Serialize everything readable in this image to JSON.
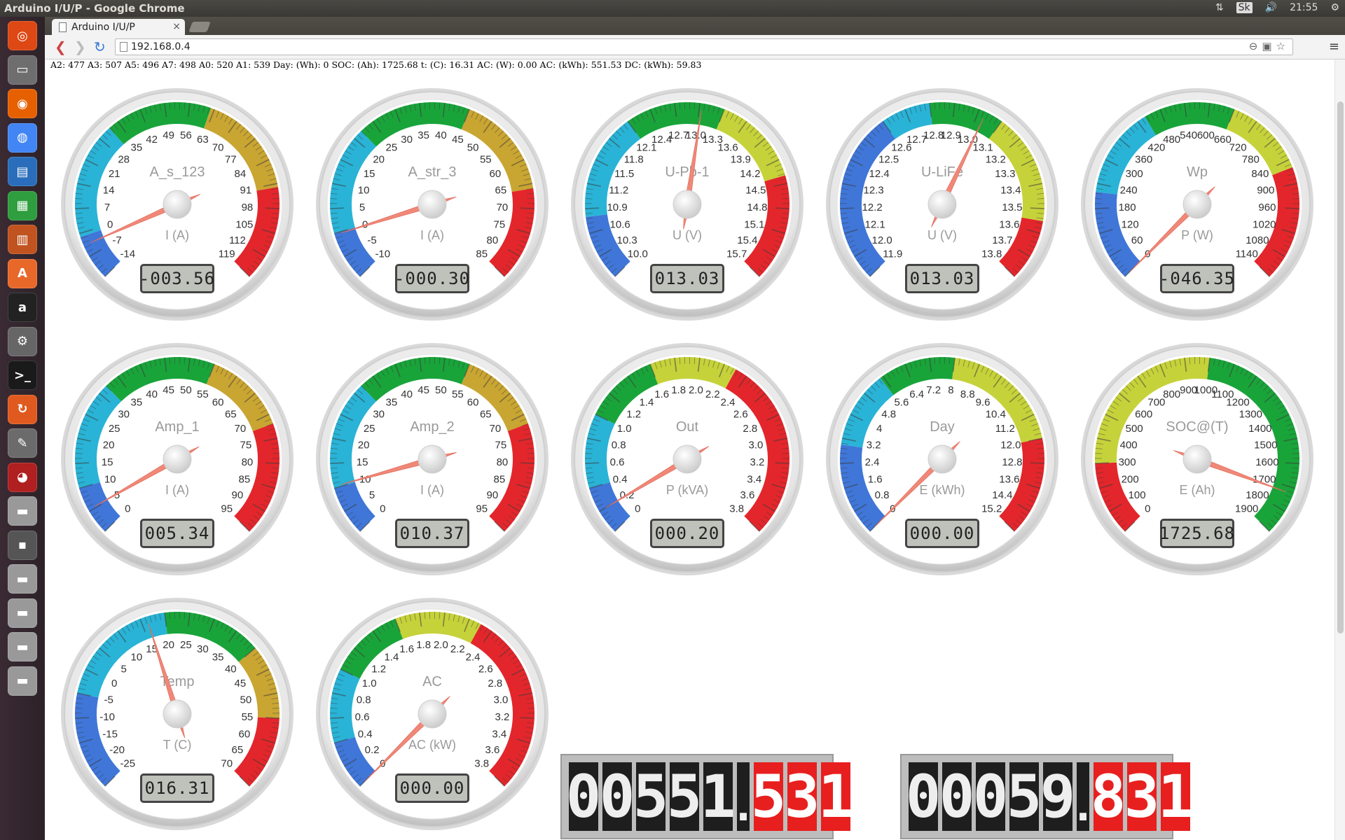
{
  "window": {
    "title": "Arduino I/U/P - Google Chrome",
    "tray": {
      "keyboard": "Sk",
      "time": "21:55"
    }
  },
  "browser": {
    "tab_title": "Arduino I/U/P",
    "tab_close": "×",
    "url": "192.168.0.4",
    "menu_icon": "≡"
  },
  "launcher_icons": [
    "ubuntu-logo-icon",
    "files-icon",
    "firefox-icon",
    "chrome-icon",
    "writer-icon",
    "calc-icon",
    "impress-icon",
    "software-center-icon",
    "amazon-icon",
    "settings-icon",
    "terminal-icon",
    "update-manager-icon",
    "gimp-icon",
    "network-icon",
    "drive-icon",
    "floppy-icon",
    "drive-icon",
    "drive-icon",
    "drive-icon",
    "drive-icon"
  ],
  "status_line": "A2: 477 A3: 507 A5: 496 A7: 498 A0: 520 A1: 539 Day: (Wh): 0 SOC: (Ah): 1725.68 t: (C): 16.31 AC: (W): 0.00 AC: (kWh): 551.53 DC: (kWh): 59.83",
  "gauges": [
    {
      "id": "g1",
      "title": "A_s_123",
      "units": "I (A)",
      "value": -3.56,
      "display": "-003.56",
      "min": -14,
      "max": 119,
      "ticks": [
        "-14",
        "-7",
        "0",
        "7",
        "14",
        "21",
        "28",
        "35",
        "42",
        "49",
        "56",
        "63",
        "70",
        "77",
        "84",
        "91",
        "98",
        "105",
        "112",
        "119"
      ],
      "highlights": [
        {
          "from": -14,
          "to": -1,
          "color": "#3f76d8"
        },
        {
          "from": -1,
          "to": 32,
          "color": "#29b3d6"
        },
        {
          "from": 32,
          "to": 62,
          "color": "#19a43a"
        },
        {
          "from": 62,
          "to": 92,
          "color": "#c9a532"
        },
        {
          "from": 92,
          "to": 119,
          "color": "#e3262b"
        }
      ]
    },
    {
      "id": "g2",
      "title": "A_str_3",
      "units": "I (A)",
      "value": -0.3,
      "display": "-000.30",
      "min": -10,
      "max": 85,
      "ticks": [
        "-10",
        "-5",
        "0",
        "5",
        "10",
        "15",
        "20",
        "25",
        "30",
        "35",
        "40",
        "45",
        "50",
        "55",
        "60",
        "65",
        "70",
        "75",
        "80",
        "85"
      ],
      "highlights": [
        {
          "from": -10,
          "to": 0,
          "color": "#3f76d8"
        },
        {
          "from": 0,
          "to": 22,
          "color": "#29b3d6"
        },
        {
          "from": 22,
          "to": 45,
          "color": "#19a43a"
        },
        {
          "from": 45,
          "to": 66,
          "color": "#c9a532"
        },
        {
          "from": 66,
          "to": 85,
          "color": "#e3262b"
        }
      ]
    },
    {
      "id": "g3",
      "title": "U-Pb-1",
      "units": "U (V)",
      "value": 13.03,
      "display": "013.03",
      "min": 10.0,
      "max": 15.7,
      "ticks": [
        "10.0",
        "10.3",
        "10.6",
        "10.9",
        "11.2",
        "11.5",
        "11.8",
        "12.1",
        "12.4",
        "12.7",
        "13.0",
        "13.3",
        "13.6",
        "13.9",
        "14.2",
        "14.5",
        "14.8",
        "15.1",
        "15.4",
        "15.7"
      ],
      "highlights": [
        {
          "from": 10.0,
          "to": 10.8,
          "color": "#3f76d8"
        },
        {
          "from": 10.8,
          "to": 12.1,
          "color": "#29b3d6"
        },
        {
          "from": 12.1,
          "to": 13.3,
          "color": "#19a43a"
        },
        {
          "from": 13.3,
          "to": 14.4,
          "color": "#c6d23a"
        },
        {
          "from": 14.4,
          "to": 15.7,
          "color": "#e3262b"
        }
      ]
    },
    {
      "id": "g4",
      "title": "U-LiFe",
      "units": "U (V)",
      "value": 13.03,
      "display": "013.03",
      "min": 11.9,
      "max": 13.8,
      "ticks": [
        "11.9",
        "12.0",
        "12.1",
        "12.2",
        "12.3",
        "12.4",
        "12.5",
        "12.6",
        "12.7",
        "12.8",
        "12.9",
        "13.0",
        "13.1",
        "13.2",
        "13.3",
        "13.4",
        "13.5",
        "13.6",
        "13.7",
        "13.8"
      ],
      "highlights": [
        {
          "from": 11.9,
          "to": 12.6,
          "color": "#3f76d8"
        },
        {
          "from": 12.6,
          "to": 12.8,
          "color": "#29b3d6"
        },
        {
          "from": 12.8,
          "to": 13.1,
          "color": "#19a43a"
        },
        {
          "from": 13.1,
          "to": 13.55,
          "color": "#c6d23a"
        },
        {
          "from": 13.55,
          "to": 13.8,
          "color": "#e3262b"
        }
      ]
    },
    {
      "id": "g5",
      "title": "Wp",
      "units": "P (W)",
      "value": -46.35,
      "display": "-046.35",
      "min": 0,
      "max": 1140,
      "ticks": [
        "0",
        "60",
        "120",
        "180",
        "240",
        "300",
        "360",
        "420",
        "480",
        "540",
        "600",
        "660",
        "720",
        "780",
        "840",
        "900",
        "960",
        "1020",
        "1080",
        "1140"
      ],
      "highlights": [
        {
          "from": 0,
          "to": 220,
          "color": "#3f76d8"
        },
        {
          "from": 220,
          "to": 440,
          "color": "#29b3d6"
        },
        {
          "from": 440,
          "to": 660,
          "color": "#19a43a"
        },
        {
          "from": 660,
          "to": 860,
          "color": "#c6d23a"
        },
        {
          "from": 860,
          "to": 1140,
          "color": "#e3262b"
        }
      ]
    },
    {
      "id": "g6",
      "title": "Amp_1",
      "units": "I (A)",
      "value": 5.34,
      "display": "005.34",
      "min": 0,
      "max": 95,
      "ticks": [
        "0",
        "5",
        "10",
        "15",
        "20",
        "25",
        "30",
        "35",
        "40",
        "45",
        "50",
        "55",
        "60",
        "65",
        "70",
        "75",
        "80",
        "85",
        "90",
        "95"
      ],
      "highlights": [
        {
          "from": 0,
          "to": 10,
          "color": "#3f76d8"
        },
        {
          "from": 10,
          "to": 32,
          "color": "#29b3d6"
        },
        {
          "from": 32,
          "to": 55,
          "color": "#19a43a"
        },
        {
          "from": 55,
          "to": 72,
          "color": "#c9a532"
        },
        {
          "from": 72,
          "to": 95,
          "color": "#e3262b"
        }
      ]
    },
    {
      "id": "g7",
      "title": "Amp_2",
      "units": "I (A)",
      "value": 10.37,
      "display": "010.37",
      "min": 0,
      "max": 95,
      "ticks": [
        "0",
        "5",
        "10",
        "15",
        "20",
        "25",
        "30",
        "35",
        "40",
        "45",
        "50",
        "55",
        "60",
        "65",
        "70",
        "75",
        "80",
        "85",
        "90",
        "95"
      ],
      "highlights": [
        {
          "from": 0,
          "to": 10,
          "color": "#3f76d8"
        },
        {
          "from": 10,
          "to": 32,
          "color": "#29b3d6"
        },
        {
          "from": 32,
          "to": 55,
          "color": "#19a43a"
        },
        {
          "from": 55,
          "to": 72,
          "color": "#c9a532"
        },
        {
          "from": 72,
          "to": 95,
          "color": "#e3262b"
        }
      ]
    },
    {
      "id": "g8",
      "title": "Out",
      "units": "P (kVA)",
      "value": 0.2,
      "display": "000.20",
      "min": 0,
      "max": 3.8,
      "ticks": [
        "0",
        "0.2",
        "0.4",
        "0.6",
        "0.8",
        "1.0",
        "1.2",
        "1.4",
        "1.6",
        "1.8",
        "2.0",
        "2.2",
        "2.4",
        "2.6",
        "2.8",
        "3.0",
        "3.2",
        "3.4",
        "3.6",
        "3.8"
      ],
      "highlights": [
        {
          "from": 0,
          "to": 0.4,
          "color": "#3f76d8"
        },
        {
          "from": 0.4,
          "to": 1.0,
          "color": "#29b3d6"
        },
        {
          "from": 1.0,
          "to": 1.6,
          "color": "#19a43a"
        },
        {
          "from": 1.6,
          "to": 2.3,
          "color": "#c6d23a"
        },
        {
          "from": 2.3,
          "to": 3.8,
          "color": "#e3262b"
        }
      ]
    },
    {
      "id": "g9",
      "title": "Day",
      "units": "E (kWh)",
      "value": 0.0,
      "display": "000.00",
      "min": 0,
      "max": 15.2,
      "ticks": [
        "0",
        "0.8",
        "1.6",
        "2.4",
        "3.2",
        "4",
        "4.8",
        "5.6",
        "6.4",
        "7.2",
        "8",
        "8.8",
        "9.6",
        "10.4",
        "11.2",
        "12.0",
        "12.8",
        "13.6",
        "14.4",
        "15.2"
      ],
      "highlights": [
        {
          "from": 0,
          "to": 3.0,
          "color": "#3f76d8"
        },
        {
          "from": 3.0,
          "to": 5.5,
          "color": "#29b3d6"
        },
        {
          "from": 5.5,
          "to": 8.0,
          "color": "#19a43a"
        },
        {
          "from": 8.0,
          "to": 12.0,
          "color": "#c6d23a"
        },
        {
          "from": 12.0,
          "to": 15.2,
          "color": "#e3262b"
        }
      ]
    },
    {
      "id": "g10",
      "title": "SOC@(T)",
      "units": "E (Ah)",
      "value": 1725.68,
      "display": "1725.68",
      "min": 0,
      "max": 1900,
      "ticks": [
        "0",
        "100",
        "200",
        "300",
        "400",
        "500",
        "600",
        "700",
        "800",
        "900",
        "1000",
        "1100",
        "1200",
        "1300",
        "1400",
        "1500",
        "1600",
        "1700",
        "1800",
        "1900"
      ],
      "highlights": [
        {
          "from": 0,
          "to": 300,
          "color": "#e3262b"
        },
        {
          "from": 300,
          "to": 1000,
          "color": "#c6d23a"
        },
        {
          "from": 1000,
          "to": 1900,
          "color": "#19a43a"
        }
      ]
    },
    {
      "id": "g11",
      "title": "Temp",
      "units": "T (C)",
      "value": 16.31,
      "display": "016.31",
      "min": -25,
      "max": 70,
      "ticks": [
        "-25",
        "-20",
        "-15",
        "-10",
        "-5",
        "0",
        "5",
        "10",
        "15",
        "20",
        "25",
        "30",
        "35",
        "40",
        "45",
        "50",
        "55",
        "60",
        "65",
        "70"
      ],
      "highlights": [
        {
          "from": -25,
          "to": -5,
          "color": "#3f76d8"
        },
        {
          "from": -5,
          "to": 20,
          "color": "#29b3d6"
        },
        {
          "from": 20,
          "to": 40,
          "color": "#19a43a"
        },
        {
          "from": 40,
          "to": 55,
          "color": "#c9a532"
        },
        {
          "from": 55,
          "to": 70,
          "color": "#e3262b"
        }
      ]
    },
    {
      "id": "g12",
      "title": "AC",
      "units": "AC (kW)",
      "value": 0.0,
      "display": "000.00",
      "min": 0,
      "max": 3.8,
      "ticks": [
        "0",
        "0.2",
        "0.4",
        "0.6",
        "0.8",
        "1.0",
        "1.2",
        "1.4",
        "1.6",
        "1.8",
        "2.0",
        "2.2",
        "2.4",
        "2.6",
        "2.8",
        "3.0",
        "3.2",
        "3.4",
        "3.6",
        "3.8"
      ],
      "highlights": [
        {
          "from": 0,
          "to": 0.4,
          "color": "#3f76d8"
        },
        {
          "from": 0.4,
          "to": 1.0,
          "color": "#29b3d6"
        },
        {
          "from": 1.0,
          "to": 1.6,
          "color": "#19a43a"
        },
        {
          "from": 1.6,
          "to": 2.3,
          "color": "#c6d23a"
        },
        {
          "from": 2.3,
          "to": 3.8,
          "color": "#e3262b"
        }
      ]
    }
  ],
  "counters": [
    {
      "id": "ac_kwh",
      "int": "00551",
      "frac": "531"
    },
    {
      "id": "dc_kwh",
      "int": "00059",
      "frac": "831"
    }
  ]
}
